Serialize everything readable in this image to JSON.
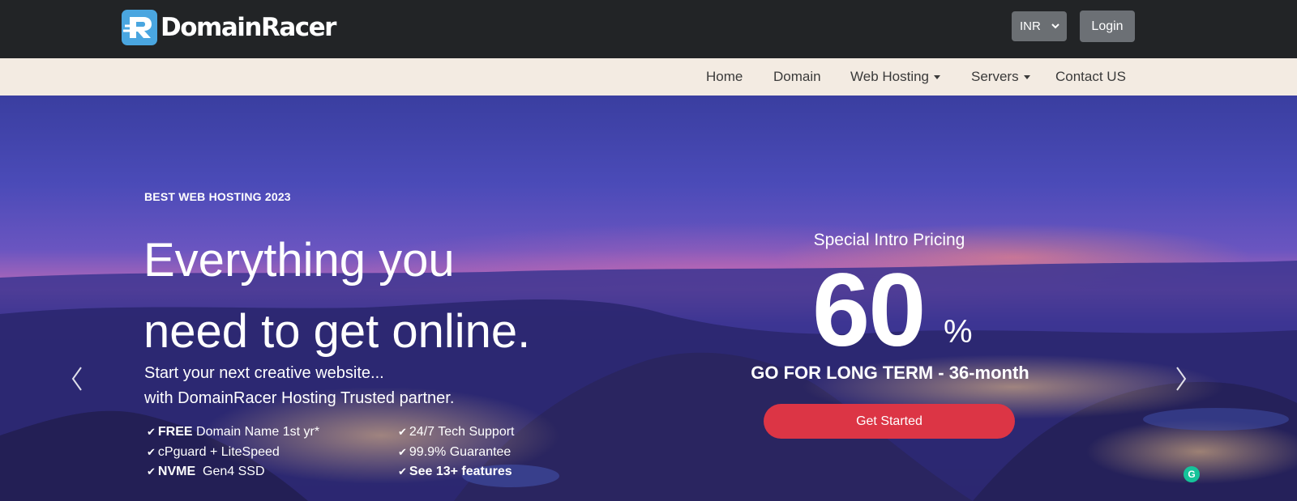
{
  "header": {
    "logo_text": "DomainRacer",
    "logo_icon": "domainracer-r-icon",
    "currency": "INR",
    "login_label": "Login"
  },
  "nav": {
    "items": [
      {
        "label": "Home"
      },
      {
        "label": "Domain"
      },
      {
        "label": "Web Hosting"
      },
      {
        "label": "Servers"
      },
      {
        "label": "Contact US"
      }
    ]
  },
  "hero": {
    "eyebrow": "BEST WEB HOSTING 2023",
    "headline_line1": "Everything you",
    "headline_line2": "need to get online.",
    "sub_line1": "Start your next creative website...",
    "sub_line2": "with DomainRacer Hosting Trusted partner.",
    "features_left": [
      {
        "bold": "FREE",
        "text": " Domain Name 1st yr*"
      },
      {
        "bold": "",
        "text": "cPguard + LiteSpeed"
      },
      {
        "bold": "NVME",
        "text": "  Gen4 SSD"
      }
    ],
    "features_right": [
      {
        "bold": "",
        "text": "24/7 Tech Support"
      },
      {
        "bold": "",
        "text": "99.9% Guarantee"
      },
      {
        "bold": "See 13+ features",
        "text": ""
      }
    ],
    "check_glyph": "✔"
  },
  "promo": {
    "title": "Special Intro Pricing",
    "value": "60",
    "unit": "%",
    "term": "GO FOR LONG TERM - 36-month",
    "cta_label": "Get Started"
  },
  "colors": {
    "topbar": "#222426",
    "navbar": "#f3ebe2",
    "cta": "#dc3545",
    "logo_blue": "#4aa6e0"
  },
  "badge": "G"
}
